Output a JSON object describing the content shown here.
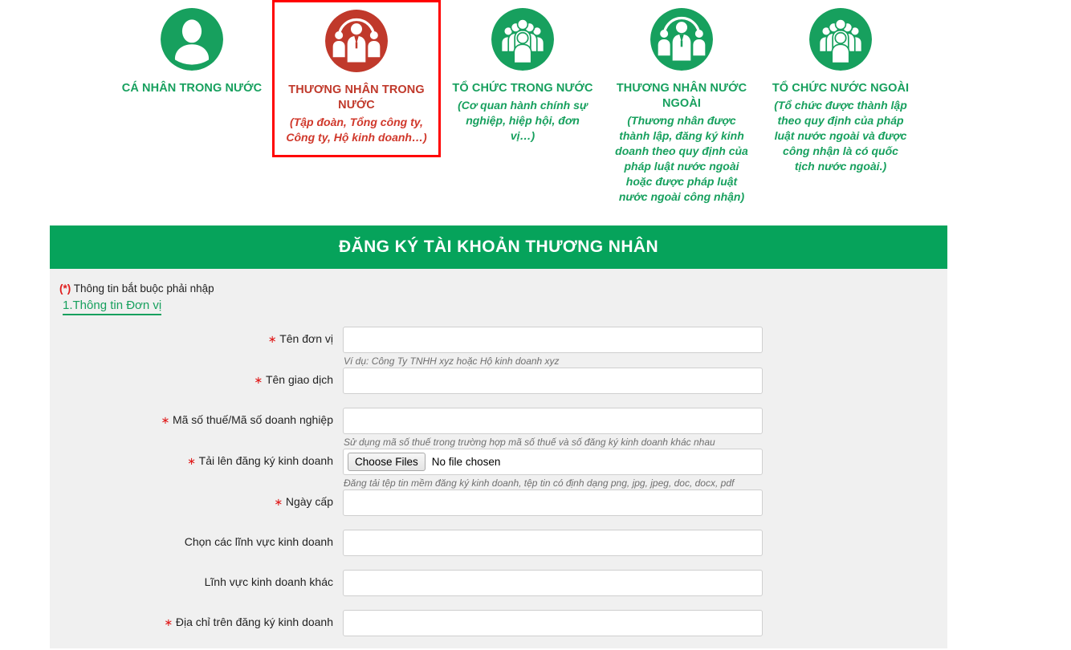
{
  "categories": [
    {
      "icon": "person-single-icon",
      "title": "CÁ NHÂN TRONG NƯỚC",
      "subtitle": "",
      "selected": false,
      "color": "#17a05e"
    },
    {
      "icon": "three-people-arc-icon",
      "title": "THƯƠNG NHÂN TRONG NƯỚC",
      "subtitle": "(Tập đoàn, Tổng công ty, Công ty, Hộ kinh doanh…)",
      "selected": true,
      "color": "#c0392b"
    },
    {
      "icon": "crowd-group-icon",
      "title": "TỔ CHỨC TRONG NƯỚC",
      "subtitle": "(Cơ quan hành chính sự nghiệp, hiệp hội, đơn vị…)",
      "selected": false,
      "color": "#17a05e"
    },
    {
      "icon": "three-people-arc-icon",
      "title": "THƯƠNG NHÂN NƯỚC NGOÀI",
      "subtitle": "(Thương nhân được thành lập, đăng ký kinh doanh theo quy định của pháp luật nước ngoài hoặc được pháp luật nước ngoài công nhận)",
      "selected": false,
      "color": "#17a05e"
    },
    {
      "icon": "crowd-group-icon",
      "title": "TỔ CHỨC NƯỚC NGOÀI",
      "subtitle": "(Tổ chức được thành lập theo quy định của pháp luật nước ngoài và được công nhận là có quốc tịch nước ngoài.)",
      "selected": false,
      "color": "#17a05e"
    }
  ],
  "form": {
    "header_title": "ĐĂNG KÝ TÀI KHOẢN THƯƠNG NHÂN",
    "required_star": "(*)",
    "required_note": "Thông tin bắt buộc phải nhập",
    "section_heading": "1.Thông tin Đơn vị",
    "fields": [
      {
        "label": "Tên đơn vị",
        "required": true,
        "type": "text",
        "value": "",
        "hint": "Ví dụ: Công Ty TNHH xyz hoặc Hộ kinh doanh xyz"
      },
      {
        "label": "Tên giao dịch",
        "required": true,
        "type": "text",
        "value": "",
        "hint": ""
      },
      {
        "label": "Mã số thuế/Mã số doanh nghiệp",
        "required": true,
        "type": "text",
        "value": "",
        "hint": "Sử dụng mã số thuế trong trường hợp mã số thuế và số đăng ký kinh doanh khác nhau"
      },
      {
        "label": "Tải lên đăng ký kinh doanh",
        "required": true,
        "type": "file",
        "button_label": "Choose Files",
        "status_text": "No file chosen",
        "hint": "Đăng tải tệp tin mềm đăng ký kinh doanh, tệp tin có định dạng png, jpg, jpeg, doc, docx, pdf"
      },
      {
        "label": "Ngày cấp",
        "required": true,
        "type": "text",
        "value": "",
        "hint": ""
      },
      {
        "label": "Chọn các lĩnh vực kinh doanh",
        "required": false,
        "type": "text",
        "value": "",
        "hint": ""
      },
      {
        "label": "Lĩnh vực kinh doanh khác",
        "required": false,
        "type": "text",
        "value": "",
        "hint": ""
      },
      {
        "label": "Địa chỉ trên đăng ký kinh doanh",
        "required": true,
        "type": "text",
        "value": "",
        "hint": ""
      }
    ]
  },
  "colors": {
    "brand_green": "#06a35b",
    "label_green": "#17a05e",
    "selected_red": "#c0392b",
    "highlight_border": "#ff0000",
    "panel_bg": "#f0f0f0"
  }
}
